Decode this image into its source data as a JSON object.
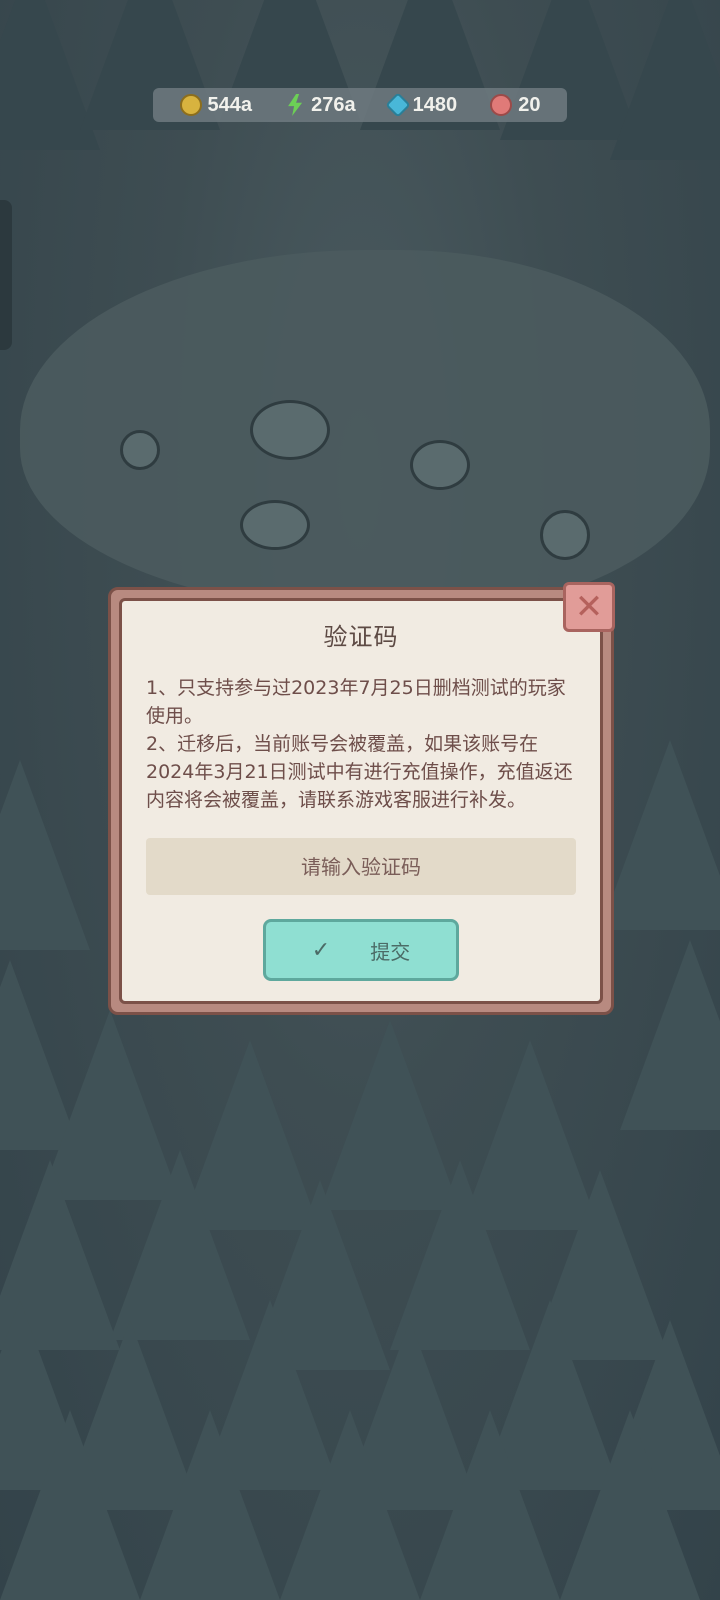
{
  "resources": [
    {
      "icon": "coin-icon",
      "value": "544a"
    },
    {
      "icon": "energy-bolt-icon",
      "value": "276a"
    },
    {
      "icon": "gem-icon",
      "value": "1480"
    },
    {
      "icon": "shell-icon",
      "value": "20"
    }
  ],
  "dialog": {
    "title": "验证码",
    "line1": "1、只支持参与过2023年7月25日删档测试的玩家使用。",
    "line2": "2、迁移后，当前账号会被覆盖，如果该账号在2024年3月21日测试中有进行充值操作，充值返还内容将会被覆盖，请联系游戏客服进行补发。",
    "input_placeholder": "请输入验证码",
    "input_value": "",
    "submit_label": "提交",
    "close_icon": "close-icon"
  },
  "colors": {
    "dialog_bg": "#f1ebe2",
    "dialog_border": "#b88a80",
    "submit_bg": "#8fdfd2",
    "close_bg": "#e19c98"
  }
}
